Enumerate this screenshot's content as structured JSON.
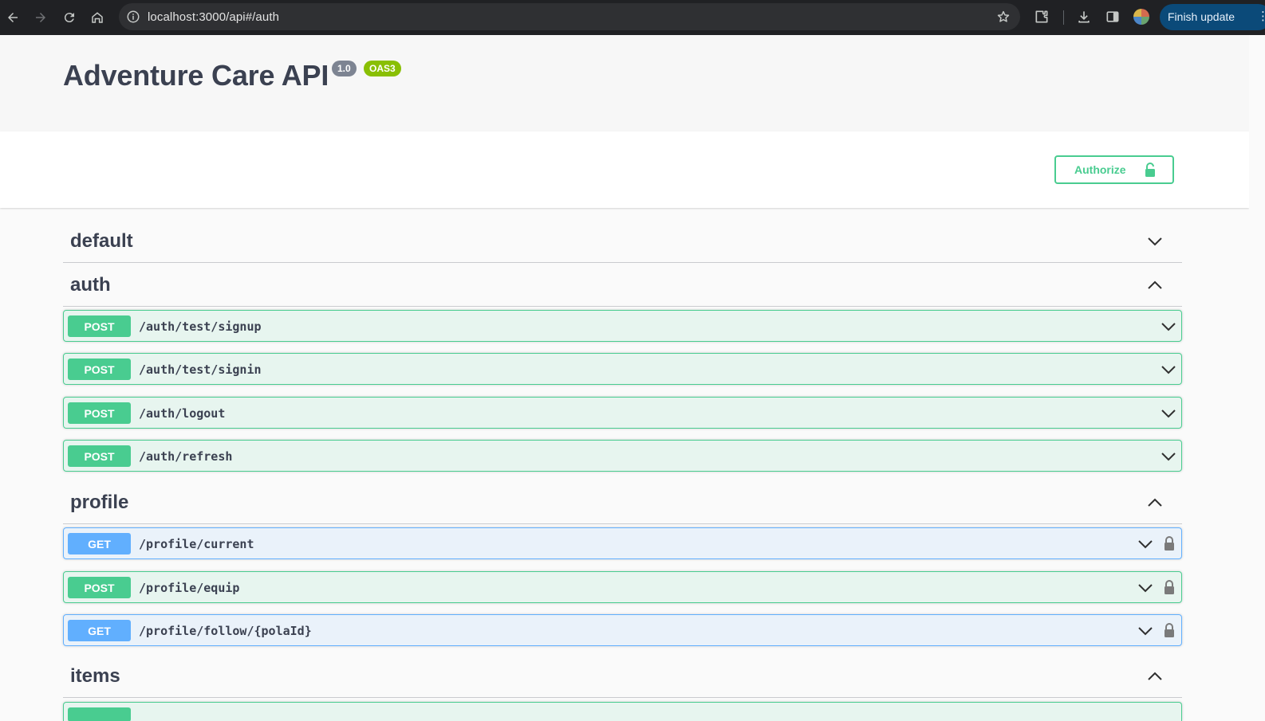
{
  "browser": {
    "url": "localhost:3000/api#/auth",
    "update_button": "Finish update",
    "icons": [
      "back-icon",
      "forward-icon",
      "reload-icon",
      "home-icon",
      "site-info-icon",
      "bookmark-star-icon",
      "extensions-icon",
      "downloads-icon",
      "side-panel-icon",
      "profile-avatar",
      "menu-dots-icon"
    ]
  },
  "api": {
    "title": "Adventure Care API",
    "version": "1.0",
    "oas": "OAS3"
  },
  "scheme": {
    "authorize_label": "Authorize"
  },
  "tags": {
    "default": {
      "name": "default"
    },
    "auth": {
      "name": "auth"
    },
    "profile": {
      "name": "profile"
    },
    "items": {
      "name": "items"
    }
  },
  "operations": {
    "auth_signup": {
      "method": "POST",
      "path": "/auth/test/signup"
    },
    "auth_signin": {
      "method": "POST",
      "path": "/auth/test/signin"
    },
    "auth_logout": {
      "method": "POST",
      "path": "/auth/logout"
    },
    "auth_refresh": {
      "method": "POST",
      "path": "/auth/refresh"
    },
    "profile_current": {
      "method": "GET",
      "path": "/profile/current"
    },
    "profile_equip": {
      "method": "POST",
      "path": "/profile/equip"
    },
    "profile_follow": {
      "method": "GET",
      "path": "/profile/follow/{polaId}"
    }
  },
  "colors": {
    "post": "#49cc90",
    "get": "#61affe",
    "text": "#3b4151",
    "chrome": "#202124",
    "update_button": "#0b4a79"
  }
}
